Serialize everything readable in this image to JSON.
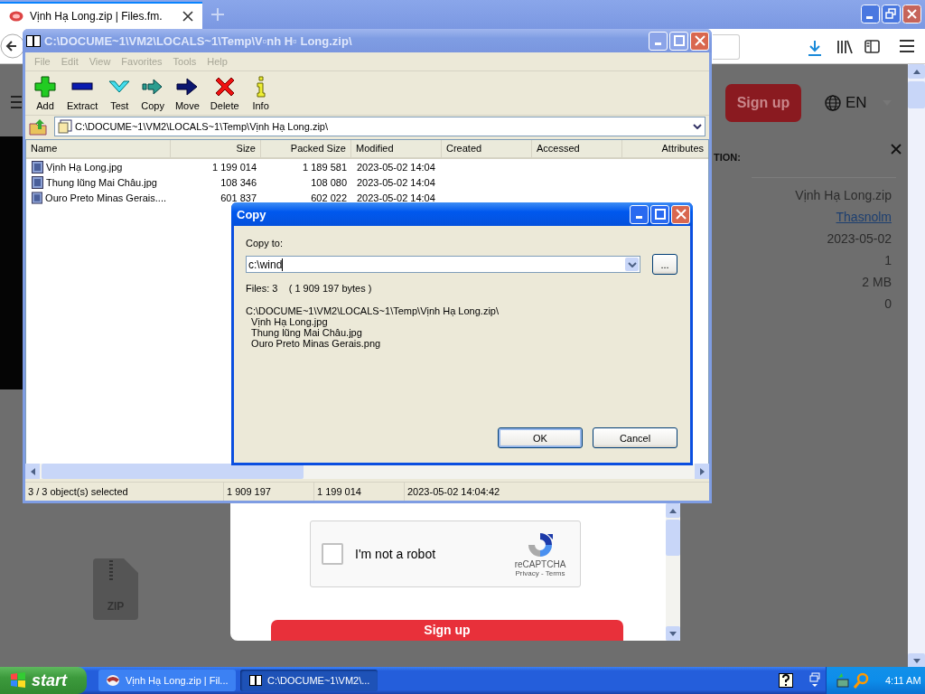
{
  "browser": {
    "tabs": [
      {
        "title": "Vịnh Hạ Long.zip | Files.fm.",
        "selected": true
      }
    ],
    "site": {
      "signup": "Sign up",
      "language": "EN",
      "panel_heading": "TION:",
      "details": [
        {
          "kind": "text",
          "value": "Vịnh Hạ Long.zip"
        },
        {
          "kind": "link",
          "value": "Thasnolm"
        },
        {
          "kind": "text",
          "value": "2023-05-02"
        },
        {
          "kind": "text",
          "value": "1"
        },
        {
          "kind": "text",
          "value": "2 MB"
        },
        {
          "kind": "text",
          "value": "0"
        }
      ],
      "file_icon_label": "ZIP",
      "captcha": {
        "label": "I'm not a robot",
        "checked": false,
        "brand": "reCAPTCHA",
        "links": "Privacy - Terms"
      },
      "submit": "Sign up"
    }
  },
  "archiver": {
    "title": "C:\\DOCUME~1\\VM2\\LOCALS~1\\Temp\\V▫nh H▫ Long.zip\\",
    "menu": [
      {
        "label": "File",
        "disabled": true
      },
      {
        "label": "Edit",
        "disabled": true
      },
      {
        "label": "View",
        "disabled": true
      },
      {
        "label": "Favorites",
        "disabled": true
      },
      {
        "label": "Tools",
        "disabled": true
      },
      {
        "label": "Help",
        "disabled": true
      }
    ],
    "toolbar": [
      {
        "kind": "add",
        "label": "Add"
      },
      {
        "kind": "extract",
        "label": "Extract"
      },
      {
        "kind": "test",
        "label": "Test"
      },
      {
        "kind": "copy",
        "label": "Copy"
      },
      {
        "kind": "move",
        "label": "Move"
      },
      {
        "kind": "delete",
        "label": "Delete"
      },
      {
        "kind": "info",
        "label": "Info"
      }
    ],
    "address": "C:\\DOCUME~1\\VM2\\LOCALS~1\\Temp\\Vịnh Hạ Long.zip\\",
    "columns": [
      "Name",
      "Size",
      "Packed Size",
      "Modified",
      "Created",
      "Accessed",
      "Attributes"
    ],
    "rows": [
      {
        "name": "Vịnh Hạ Long.jpg",
        "size": "1 199 014",
        "packed": "1 189 581",
        "modified": "2023-05-02 14:04"
      },
      {
        "name": "Thung lũng Mai Châu.jpg",
        "size": "108 346",
        "packed": "108 080",
        "modified": "2023-05-02 14:04"
      },
      {
        "name": "Ouro Preto Minas Gerais....",
        "size": "601 837",
        "packed": "602 022",
        "modified": "2023-05-02 14:04"
      }
    ],
    "status": [
      "3 / 3 object(s) selected",
      "1 909 197",
      "1 199 014",
      "2023-05-02 14:04:42"
    ]
  },
  "dialog": {
    "title": "Copy",
    "label": "Copy to:",
    "value": "c:\\wind",
    "browse": "...",
    "summary": "Files: 3    ( 1 909 197 bytes )",
    "lines": [
      "C:\\DOCUME~1\\VM2\\LOCALS~1\\Temp\\Vịnh Hạ Long.zip\\",
      "  Vịnh Hạ Long.jpg",
      "  Thung lũng Mai Châu.jpg",
      "  Ouro Preto Minas Gerais.png"
    ],
    "buttons": [
      {
        "label": "OK",
        "default": true
      },
      {
        "label": "Cancel",
        "default": false
      }
    ]
  },
  "taskbar": {
    "start": "start",
    "tasks": [
      {
        "label": "Vịnh Hạ Long.zip | Fil...",
        "kind": "browser",
        "selected": false
      },
      {
        "label": "C:\\DOCUME~1\\VM2\\...",
        "kind": "archiver",
        "selected": true
      }
    ],
    "clock": "4:11 AM"
  }
}
